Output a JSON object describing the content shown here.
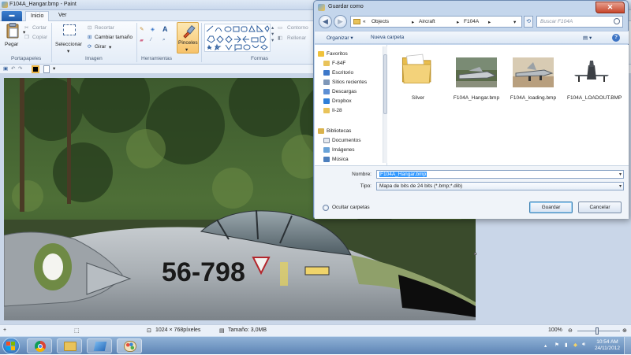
{
  "paint": {
    "title": "F104A_Hangar.bmp - Paint",
    "tabs": [
      "",
      "Inicio",
      "Ver"
    ],
    "ribbon": {
      "portapapeles": {
        "label": "Portapapeles",
        "pegar": "Pegar",
        "cortar": "Cortar",
        "copiar": "Copiar"
      },
      "imagen": {
        "label": "Imagen",
        "seleccionar": "Seleccionar",
        "recortar": "Recortar",
        "cambiar_tamano": "Cambiar tamaño",
        "girar": "Girar"
      },
      "herramientas": {
        "label": "Herramientas",
        "pinceles": "Pinceles"
      },
      "formas": {
        "label": "Formas",
        "contorno": "Contorno",
        "rellenar": "Rellenar"
      }
    },
    "image": {
      "serial": "56-798"
    },
    "status": {
      "dimensions": "1024 × 768píxeles",
      "size": "Tamaño: 3,0MB",
      "zoom": "100%"
    }
  },
  "dialog": {
    "title": "Guardar como",
    "breadcrumb": [
      "«",
      "Objects",
      "Aircraft",
      "F104A"
    ],
    "search_placeholder": "Buscar F104A",
    "toolbar": {
      "organize": "Organizar",
      "new_folder": "Nueva carpeta"
    },
    "nav": {
      "favorites_head": "Favoritos",
      "favorites": [
        "F-84F",
        "Escritorio",
        "Sitios recientes",
        "Descargas",
        "Dropbox",
        "Il-28"
      ],
      "libraries_head": "Bibliotecas",
      "libraries": [
        "Documentos",
        "Imágenes",
        "Música"
      ]
    },
    "files": [
      {
        "name": "Silver",
        "kind": "folder"
      },
      {
        "name": "F104A_Hangar.bmp",
        "kind": "photo-hangar"
      },
      {
        "name": "F104A_loading.bmp",
        "kind": "photo-loading"
      },
      {
        "name": "F104A_LOADOUT.BMP",
        "kind": "photo-loadout"
      }
    ],
    "fields": {
      "name_label": "Nombre:",
      "name_value": "F104A_Hangar.bmp",
      "type_label": "Tipo:",
      "type_value": "Mapa de bits de 24 bits (*.bmp;*.dib)"
    },
    "hide_folders": "Ocultar carpetas",
    "save_label": "Guardar",
    "cancel_label": "Cancelar"
  },
  "taskbar": {
    "time": "10:54 AM",
    "date": "24/11/2012"
  },
  "colors": {
    "accent": "#3399ff",
    "ribbon": "#e3ecf7",
    "taskbar": "#5d84b5",
    "dialog_chrome": "#c4d6ec"
  }
}
